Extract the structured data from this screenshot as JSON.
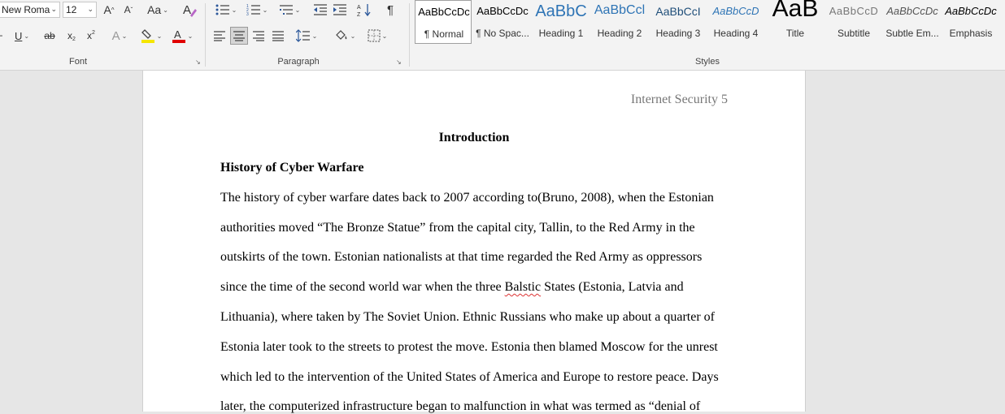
{
  "ribbon": {
    "font": {
      "label": "Font",
      "font_name": "New Roma",
      "font_size": "12",
      "grow_label": "A",
      "shrink_label": "A",
      "case_label": "Aa",
      "underline_label": "U",
      "strike_label": "ab",
      "sub_label": "x",
      "sup_label": "x",
      "effects_label": "A",
      "highlight_color": "#f5e600",
      "font_color": "#e00000"
    },
    "paragraph": {
      "label": "Paragraph"
    },
    "styles": {
      "label": "Styles",
      "items": [
        {
          "preview": "AaBbCcDc",
          "name": "¶ Normal"
        },
        {
          "preview": "AaBbCcDc",
          "name": "¶ No Spac..."
        },
        {
          "preview": "AaBbC",
          "name": "Heading 1"
        },
        {
          "preview": "AaBbCcl",
          "name": "Heading 2"
        },
        {
          "preview": "AaBbCcI",
          "name": "Heading 3"
        },
        {
          "preview": "AaBbCcD",
          "name": "Heading 4"
        },
        {
          "preview": "AaB",
          "name": "Title"
        },
        {
          "preview": "AaBbCcD",
          "name": "Subtitle"
        },
        {
          "preview": "AaBbCcDc",
          "name": "Subtle Em..."
        },
        {
          "preview": "AaBbCcDc",
          "name": "Emphasis"
        }
      ]
    }
  },
  "document": {
    "header": "Internet Security 5",
    "title": "Introduction",
    "subheading": "History of Cyber Warfare",
    "lines": [
      {
        "text": "The history of cyber warfare dates back to 2007 according to(Bruno, 2008), when the Estonian"
      },
      {
        "text": "authorities moved “The Bronze Statue” from the capital city, Tallin, to the Red Army in the"
      },
      {
        "text": "outskirts of the town. Estonian nationalists at that time regarded the Red Army as oppressors"
      },
      {
        "pre": "since the time of the second world war when the three ",
        "misspelled": "Balstic",
        "post": " States (Estonia, Latvia and"
      },
      {
        "text": "Lithuania), where taken by The Soviet Union. Ethnic Russians who make up about a quarter of"
      },
      {
        "text": "Estonia later took to the streets to protest the move. Estonia then blamed Moscow for the unrest"
      },
      {
        "text": "which led to the intervention of the United States of America and Europe to restore peace. Days"
      },
      {
        "text": "later, the computerized infrastructure began to malfunction in what was termed as “denial of"
      }
    ]
  }
}
